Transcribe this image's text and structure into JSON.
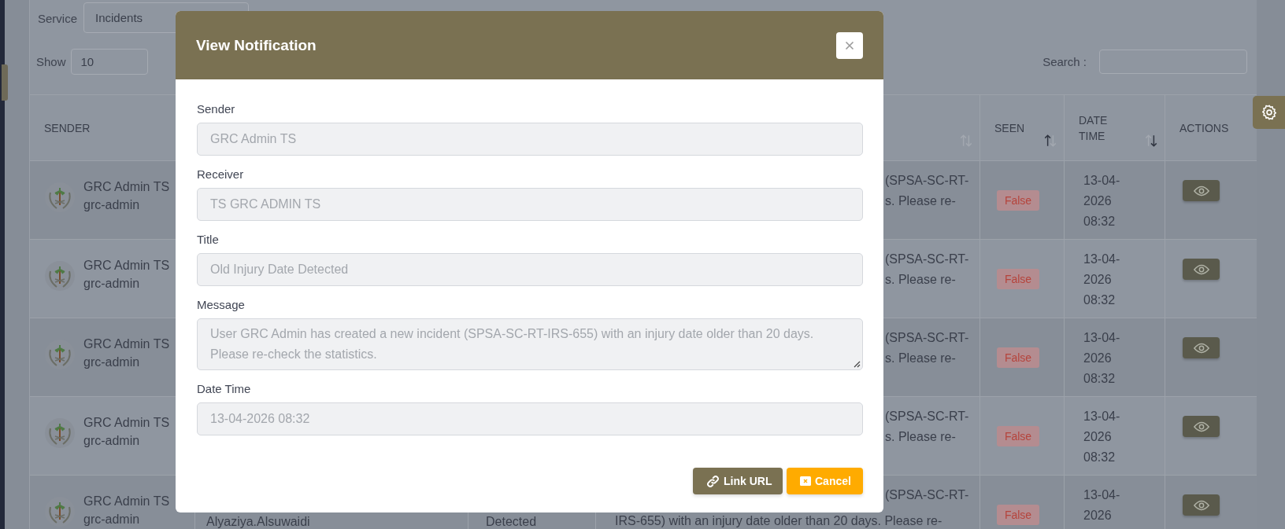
{
  "filters": {
    "service_label": "Service",
    "service_value": "Incidents",
    "show_label": "Show",
    "show_value": "10",
    "search_label": "Search :"
  },
  "table": {
    "columns": [
      {
        "label": "SENDER"
      },
      {},
      {},
      {
        "sort_up_active": false,
        "sort_down_active": false
      },
      {
        "label": "SEEN",
        "sort_up_active": true,
        "sort_down_active": false
      },
      {
        "label": "DATE TIME",
        "sort_up_active": false,
        "sort_down_active": true
      },
      {
        "label": "ACTIONS"
      }
    ],
    "rows": [
      {
        "sender_name": "GRC Admin TS",
        "sender_id": "grc-admin",
        "message_tail": [
          "(SPSA-SC-RT-",
          "s. Please re-"
        ],
        "seen": false,
        "seen_label": "False",
        "date_time": "13-04-2026 08:32"
      },
      {
        "sender_name": "GRC Admin TS",
        "sender_id": "grc-admin",
        "message_tail": [
          "(SPSA-SC-RT-",
          "s. Please re-"
        ],
        "seen": false,
        "seen_label": "False",
        "date_time": "13-04-2026 08:32"
      },
      {
        "sender_name": "GRC Admin TS",
        "sender_id": "grc-admin",
        "message_tail": [
          "(SPSA-SC-RT-",
          "s. Please re-"
        ],
        "seen": false,
        "seen_label": "False",
        "date_time": "13-04-2026 08:32"
      },
      {
        "sender_name": "GRC Admin TS",
        "sender_id": "grc-admin",
        "message_tail": [
          "(SPSA-SC-RT-",
          "s. Please re-"
        ],
        "seen": false,
        "seen_label": "False",
        "date_time": "13-04-2026 08:32"
      },
      {
        "sender_name": "GRC Admin TS",
        "sender_id": "grc-admin",
        "receiver_lines": [
          "Alyaziya.Alsuwaidi"
        ],
        "title_lines": [
          "Detected"
        ],
        "message_tail": [
          "(SPSA-SC-RT-"
        ],
        "message_lines": [
          "IRS-655) with an injury date older than 20 days. Please re-"
        ],
        "seen": false,
        "seen_label": "False",
        "date_time": "13-04-2026"
      }
    ]
  },
  "modal": {
    "title": "View Notification",
    "fields": [
      {
        "label": "Sender",
        "value": "GRC Admin TS",
        "kind": "input"
      },
      {
        "label": "Receiver",
        "value": "TS GRC ADMIN TS",
        "kind": "input"
      },
      {
        "label": "Title",
        "value": "Old Injury Date Detected",
        "kind": "input"
      },
      {
        "label": "Message",
        "value": "User GRC Admin has created a new incident (SPSA-SC-RT-IRS-655) with an injury date older than 20 days. Please re-check the statistics.",
        "kind": "textarea"
      },
      {
        "label": "Date Time",
        "value": "13-04-2026 08:32",
        "kind": "input"
      }
    ],
    "buttons": [
      {
        "label": "Link URL",
        "kind": "link"
      },
      {
        "label": "Cancel",
        "kind": "cancel"
      }
    ]
  }
}
